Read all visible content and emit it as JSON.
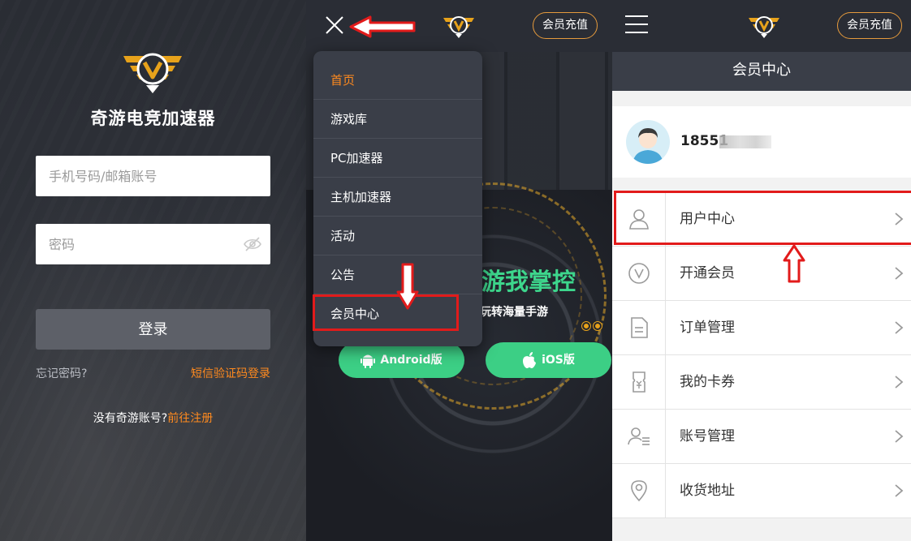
{
  "colors": {
    "accent_orange": "#ff8a1e",
    "brand_gold": "#e7a21b",
    "green": "#3dd68c",
    "annotation_red": "#e21b1b",
    "dark_bg": "#2a2d35"
  },
  "login": {
    "brand_name": "奇游电竞加速器",
    "phone_placeholder": "手机号码/邮箱账号",
    "password_placeholder": "密码",
    "login_button": "登录",
    "forgot_password": "忘记密码?",
    "sms_login": "短信验证码登录",
    "no_account": "没有奇游账号?",
    "register": "前往注册"
  },
  "home": {
    "vip_recharge": "会员充值",
    "menu": [
      {
        "label": "首页",
        "active": true
      },
      {
        "label": "游戏库",
        "active": false
      },
      {
        "label": "PC加速器",
        "active": false
      },
      {
        "label": "主机加速器",
        "active": false
      },
      {
        "label": "活动",
        "active": false
      },
      {
        "label": "公告",
        "active": false
      },
      {
        "label": "会员中心",
        "active": false
      }
    ],
    "slogan": "游我掌控",
    "sub_slogan": "玩转海量手游",
    "android_button": "Android版",
    "ios_button": "iOS版"
  },
  "member": {
    "vip_recharge": "会员充值",
    "title": "会员中心",
    "username": "18551",
    "items": [
      {
        "label": "用户中心",
        "icon": "user-icon"
      },
      {
        "label": "开通会员",
        "icon": "vip-icon"
      },
      {
        "label": "订单管理",
        "icon": "order-icon"
      },
      {
        "label": "我的卡券",
        "icon": "coupon-icon"
      },
      {
        "label": "账号管理",
        "icon": "account-icon"
      },
      {
        "label": "收货地址",
        "icon": "location-icon"
      }
    ]
  }
}
